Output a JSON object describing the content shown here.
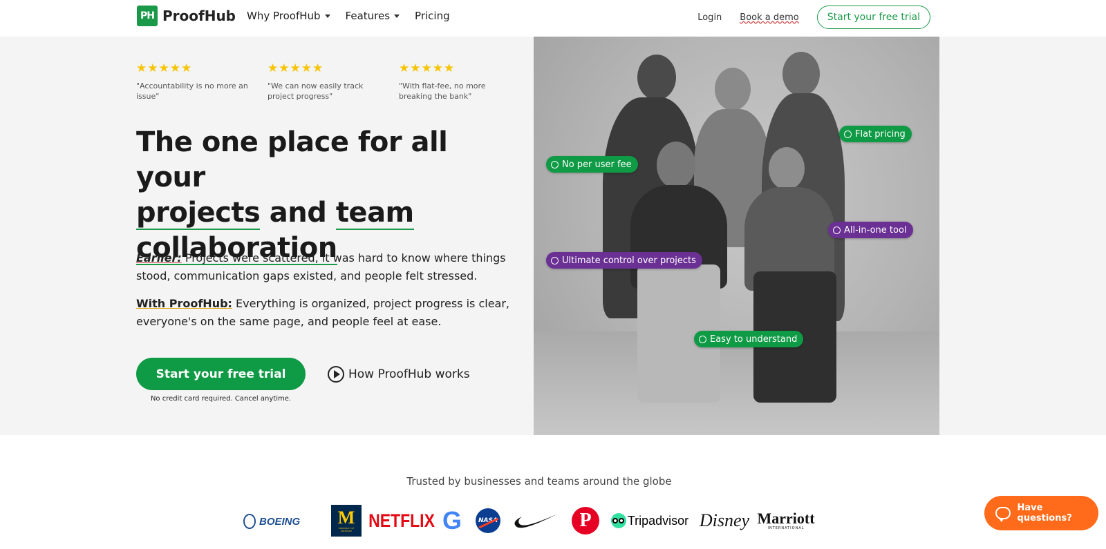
{
  "nav": {
    "logo_mark": "PH",
    "logo_text": "ProofHub",
    "menu": [
      {
        "label": "Why ProofHub",
        "dropdown": true
      },
      {
        "label": "Features",
        "dropdown": true
      },
      {
        "label": "Pricing",
        "dropdown": false
      }
    ],
    "login": "Login",
    "demo": "Book a demo",
    "cta": "Start your free trial"
  },
  "reviews": [
    {
      "stars": "★★★★★",
      "text": "\"Accountability is no more an issue\""
    },
    {
      "stars": "★★★★★",
      "text": "\"We can now easily track project progress\""
    },
    {
      "stars": "★★★★★",
      "text": "\"With flat-fee, no more breaking the bank\""
    }
  ],
  "hero": {
    "headline_part1": "The one place for all your",
    "headline_word1": "projects",
    "headline_and": "and",
    "headline_word2": "team",
    "headline_word3": "collaboration",
    "earlier_label": "Earlier:",
    "earlier_text": " Projects were scattered, it was hard to know where things stood, communication gaps existed, and people felt stressed.",
    "with_label": "With ProofHub:",
    "with_text": " Everything is organized, project progress is clear, everyone's on the same page, and people feel at ease.",
    "cta": "Start your free trial",
    "cta_note": "No credit card required. Cancel anytime.",
    "how_label": "How ProofHub works"
  },
  "tags": {
    "flat_pricing": "Flat pricing",
    "no_per_user": "No per user fee",
    "all_in_one": "All-in-one tool",
    "ultimate_control": "Ultimate control over projects",
    "easy": "Easy to understand"
  },
  "colors": {
    "brand_green": "#0f9a45",
    "tag_purple": "#6a3093",
    "help_orange": "#ff6b1a",
    "star_yellow": "#f6c400"
  },
  "trust": {
    "title": "Trusted by businesses and teams around the globe",
    "logos": [
      "BOEING",
      "UNIVERSITY OF MICHIGAN",
      "NETFLIX",
      "G",
      "NASA",
      "Nike swoosh",
      "Pinterest",
      "Tripadvisor",
      "Disney",
      "Marriott"
    ],
    "michigan_sub": "UNIVERSITY OF MICHIGAN",
    "marriott_sub": "INTERNATIONAL"
  },
  "help": {
    "label": "Have questions?"
  }
}
